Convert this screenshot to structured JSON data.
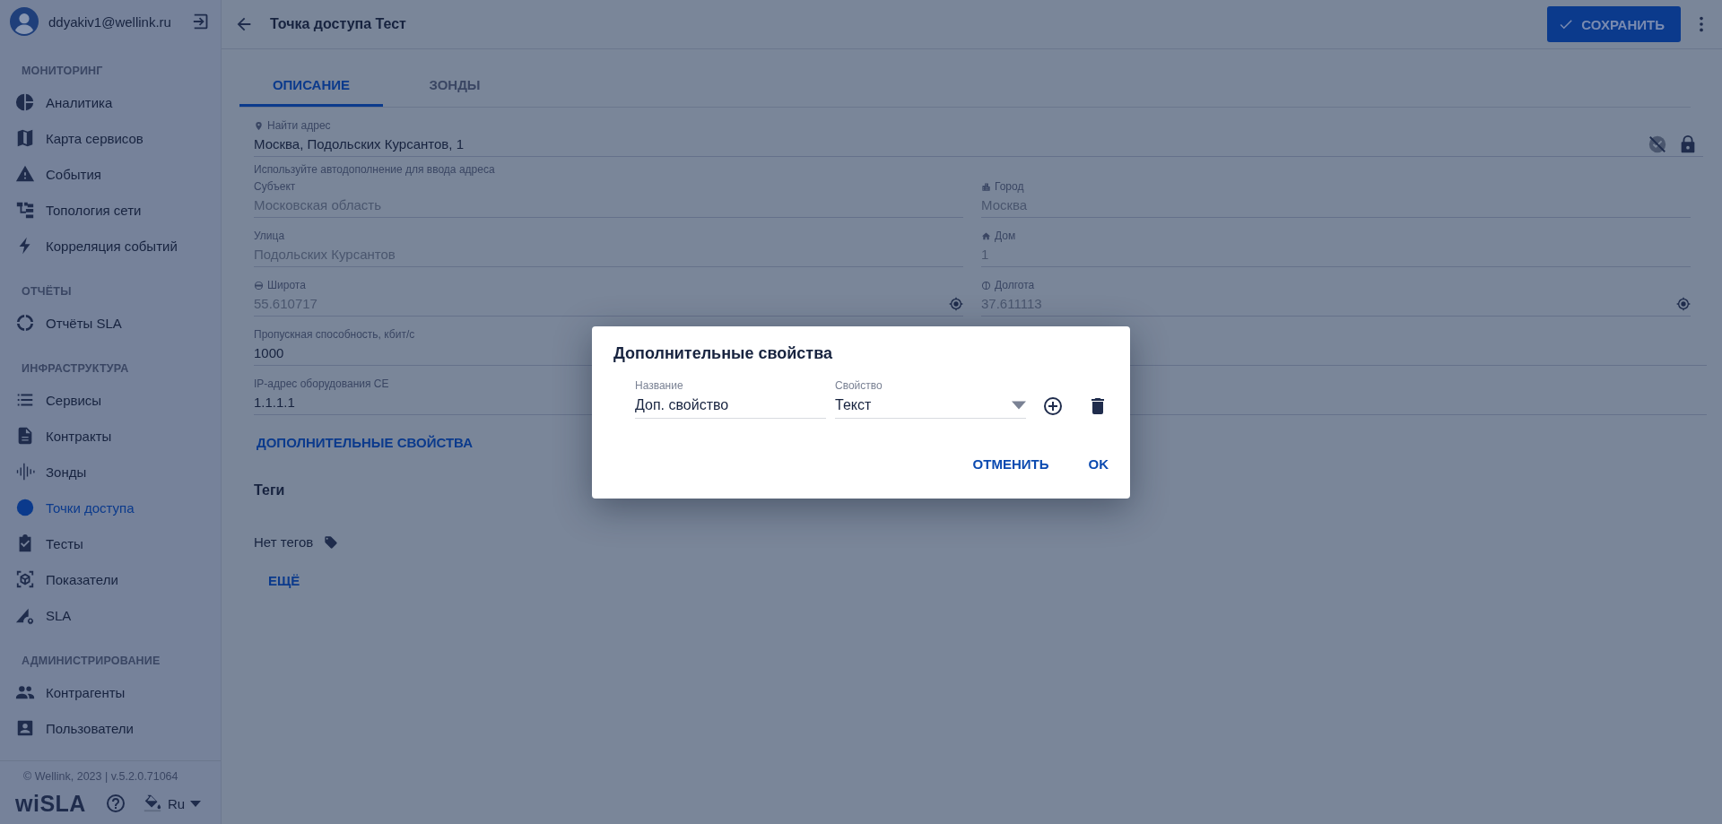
{
  "user": {
    "email": "ddyakiv1@wellink.ru"
  },
  "sidebar": {
    "sections": [
      {
        "title": "МОНИТОРИНГ",
        "items": [
          {
            "label": "Аналитика",
            "selected": false
          },
          {
            "label": "Карта сервисов",
            "selected": false
          },
          {
            "label": "События",
            "selected": false
          },
          {
            "label": "Топология сети",
            "selected": false
          },
          {
            "label": "Корреляция событий",
            "selected": false
          }
        ]
      },
      {
        "title": "ОТЧЁТЫ",
        "items": [
          {
            "label": "Отчёты SLA",
            "selected": false
          }
        ]
      },
      {
        "title": "ИНФРАСТРУКТУРА",
        "items": [
          {
            "label": "Сервисы",
            "selected": false
          },
          {
            "label": "Контракты",
            "selected": false
          },
          {
            "label": "Зонды",
            "selected": false
          },
          {
            "label": "Точки доступа",
            "selected": true
          },
          {
            "label": "Тесты",
            "selected": false
          },
          {
            "label": "Показатели",
            "selected": false
          },
          {
            "label": "SLA",
            "selected": false
          }
        ]
      },
      {
        "title": "АДМИНИСТРИРОВАНИЕ",
        "items": [
          {
            "label": "Контрагенты",
            "selected": false
          },
          {
            "label": "Пользователи",
            "selected": false
          }
        ]
      }
    ]
  },
  "footer": {
    "copyright": "© Wellink, 2023 | v.5.2.0.71064",
    "logo": "wiSLA",
    "language": "Ru"
  },
  "header": {
    "title": "Точка доступа Тест",
    "save_button": "СОХРАНИТЬ"
  },
  "tabs": [
    {
      "label": "ОПИСАНИЕ",
      "selected": true
    },
    {
      "label": "ЗОНДЫ",
      "selected": false
    }
  ],
  "form": {
    "address": {
      "label": "Найти адрес",
      "value": "Москва, Подольских Курсантов, 1",
      "hint": "Используйте автодополнение для ввода адреса",
      "disabled": false
    },
    "subject": {
      "label": "Субъект",
      "value": "Московская область",
      "disabled": true
    },
    "city": {
      "label": "Город",
      "value": "Москва",
      "disabled": true
    },
    "street": {
      "label": "Улица",
      "value": "Подольских Курсантов",
      "disabled": true
    },
    "house": {
      "label": "Дом",
      "value": "1",
      "disabled": true
    },
    "latitude": {
      "label": "Широта",
      "value": "55.610717",
      "disabled": true
    },
    "longitude": {
      "label": "Долгота",
      "value": "37.611113",
      "disabled": true
    },
    "bandwidth": {
      "label": "Пропускная способность, кбит/с",
      "value": "1000",
      "disabled": false
    },
    "ip": {
      "label": "IP-адрес оборудования CE",
      "value": "1.1.1.1",
      "disabled": false
    }
  },
  "additional_properties_button": "ДОПОЛНИТЕЛЬНЫЕ СВОЙСТВА",
  "tags": {
    "title": "Теги",
    "empty_text": "Нет тегов"
  },
  "more_button": "ЕЩЁ",
  "dialog": {
    "title": "Дополнительные свойства",
    "rows": [
      {
        "name_label": "Название",
        "name_value": "Доп. свойство",
        "property_label": "Свойство",
        "property_value": "Текст"
      }
    ],
    "buttons": [
      "ОТМЕНИТЬ",
      "OK"
    ]
  }
}
